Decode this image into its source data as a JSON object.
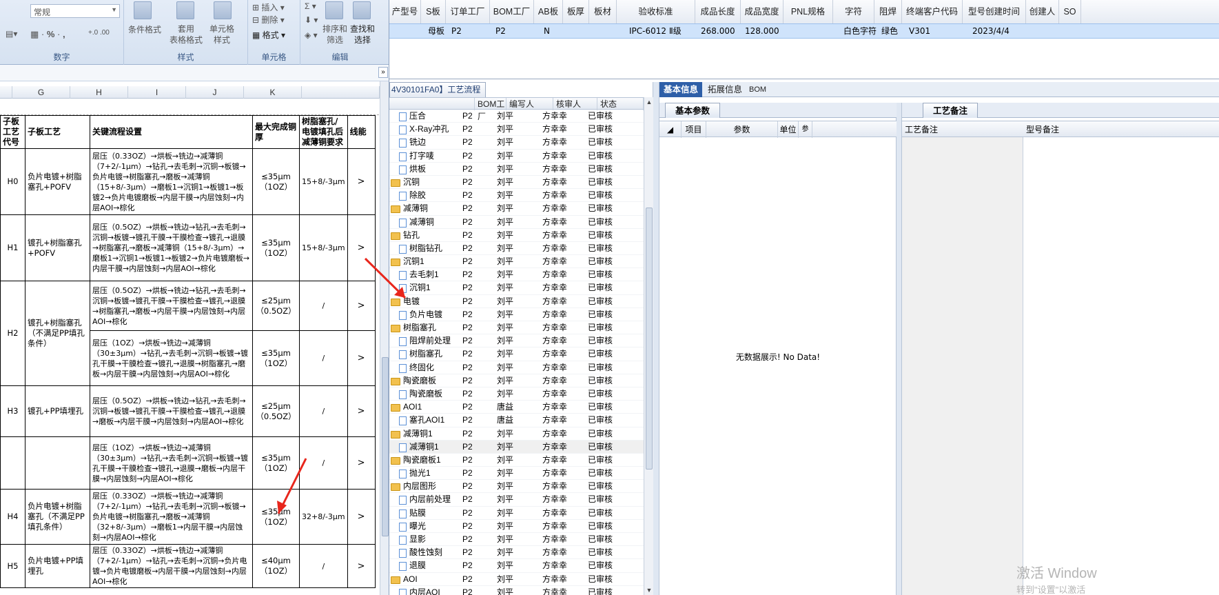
{
  "excel": {
    "number_format": "常规",
    "ribbon": {
      "groups": [
        {
          "label": "数字"
        },
        {
          "label": "样式"
        },
        {
          "label": "单元格"
        },
        {
          "label": "编辑"
        }
      ],
      "buttons": {
        "conditional_format": "条件格式",
        "table_format": "套用\n表格格式",
        "cell_style": "单元格\n样式",
        "insert": "插入",
        "delete": "删除",
        "format": "格式",
        "sort_filter": "排序和\n筛选",
        "find_select": "查找和\n选择"
      }
    },
    "columns": [
      "G",
      "H",
      "I",
      "J",
      "K"
    ],
    "table_headers": [
      "子板工艺代号",
      "子板工艺",
      "关键流程设置",
      "最大完成铜厚",
      "树脂塞孔/电镀填孔后减薄铜要求",
      "线能"
    ],
    "rows": [
      {
        "code": "H0",
        "name": "负片电镀+树脂塞孔+POFV",
        "process": "层压（0.33OZ）→烘板→铣边→减薄铜（7+2/-1μm）→钻孔→去毛刺→沉铜→板镀→负片电镀→树脂塞孔→磨板→减薄铜（15+8/-3μm）→磨板1→沉铜1→板镀1→板镀2→负片电镀磨板→内层干膜→内层蚀刻→内层AOI→棕化",
        "thick": "≤35μm（1OZ）",
        "req": "15+8/-3μm",
        "last": ">"
      },
      {
        "code": "H1",
        "name": "镀孔+树脂塞孔+POFV",
        "process": "层压（0.5OZ）→烘板→铣边→钻孔→去毛刺→沉铜→板镀→镀孔干膜→干膜检查→镀孔→退膜→树脂塞孔→磨板→减薄铜（15+8/-3μm）→磨板1→沉铜1→板镀1→板镀2→负片电镀磨板→内层干膜→内层蚀刻→内层AOI→棕化",
        "thick": "≤35μm（1OZ）",
        "req": "15+8/-3μm",
        "last": ">"
      },
      {
        "code": "H2",
        "name": "镀孔+树脂塞孔（不满足PP填孔条件）",
        "process": "层压（0.5OZ）→烘板→铣边→钻孔→去毛刺→沉铜→板镀→镀孔干膜→干膜检查→镀孔→退膜→树脂塞孔→磨板→内层干膜→内层蚀刻→内层AOI→棕化",
        "thick": "≤25μm（0.5OZ）",
        "req": "/",
        "last": ">"
      },
      {
        "code": "",
        "name": "",
        "process": "层压（1OZ）→烘板→铣边→减薄铜（30±3μm）→钻孔→去毛刺→沉铜→板镀→镀孔干膜→干膜检查→镀孔→退膜→树脂塞孔→磨板→内层干膜→内层蚀刻→内层AOI→棕化",
        "thick": "≤35μm（1OZ）",
        "req": "/",
        "last": ">"
      },
      {
        "code": "H3",
        "name": "镀孔+PP填埋孔",
        "process": "层压（0.5OZ）→烘板→铣边→钻孔→去毛刺→沉铜→板镀→镀孔干膜→干膜检查→镀孔→退膜→磨板→内层干膜→内层蚀刻→内层AOI→棕化",
        "thick": "≤25μm（0.5OZ）",
        "req": "/",
        "last": ">"
      },
      {
        "code": "",
        "name": "",
        "process": "层压（1OZ）→烘板→铣边→减薄铜（30±3μm）→钻孔→去毛刺→沉铜→板镀→镀孔干膜→干膜检查→镀孔→退膜→磨板→内层干膜→内层蚀刻→内层AOI→棕化",
        "thick": "≤35μm（1OZ）",
        "req": "/",
        "last": ">"
      },
      {
        "code": "H4",
        "name": "负片电镀+树脂塞孔（不满足PP填孔条件）",
        "process": "层压（0.33OZ）→烘板→铣边→减薄铜（7+2/-1μm）→钻孔→去毛刺→沉铜→板镀→负片电镀→树脂塞孔→磨板→减薄铜（32+8/-3μm）→磨板1→内层干膜→内层蚀刻→内层AOI→棕化",
        "thick": "≤35μm（1OZ）",
        "req": "32+8/-3μm",
        "last": ">"
      },
      {
        "code": "H5",
        "name": "负片电镀+PP填埋孔",
        "process": "层压（0.33OZ）→烘板→铣边→减薄铜（7+2/-1μm）→钻孔→去毛刺→沉铜→负片电镀→负片电镀磨板→内层干膜→内层蚀刻→内层AOI→棕化",
        "thick": "≤40μm（1OZ）",
        "req": "/",
        "last": ">"
      }
    ]
  },
  "erp": {
    "top_grid": {
      "headers": [
        "产型号",
        "S板",
        "订单工厂",
        "BOM工厂",
        "AB板",
        "板厚",
        "板材",
        "验收标准",
        "成品长度",
        "成品宽度",
        "PNL规格",
        "字符",
        "阻焊",
        "终端客户代码",
        "型号创建时间",
        "创建人",
        "SO"
      ],
      "row": {
        "type": "母板",
        "order_factory": "P2",
        "bom_factory": "P2",
        "ab": "N",
        "standard": "IPC-6012 Ⅱ级",
        "length": "268.000",
        "width": "128.000",
        "char": "白色字符",
        "solder": "绿色",
        "customer": "V301",
        "created": "2023/4/4"
      }
    },
    "tree": {
      "tab_title": "4V30101FA0】工艺流程",
      "headers": [
        "BOM工厂",
        "编写人",
        "核审人",
        "状态"
      ],
      "rows": [
        {
          "name": "压合",
          "level": 1,
          "folder": false,
          "bom": "P2",
          "writer": "刘平",
          "auditor": "方幸幸",
          "status": "已审核"
        },
        {
          "name": "X-Ray冲孔",
          "level": 1,
          "folder": false,
          "bom": "P2",
          "writer": "刘平",
          "auditor": "方幸幸",
          "status": "已审核"
        },
        {
          "name": "铣边",
          "level": 1,
          "folder": false,
          "bom": "P2",
          "writer": "刘平",
          "auditor": "方幸幸",
          "status": "已审核"
        },
        {
          "name": "打字唛",
          "level": 1,
          "folder": false,
          "bom": "P2",
          "writer": "刘平",
          "auditor": "方幸幸",
          "status": "已审核"
        },
        {
          "name": "烘板",
          "level": 1,
          "folder": false,
          "bom": "P2",
          "writer": "刘平",
          "auditor": "方幸幸",
          "status": "已审核"
        },
        {
          "name": "沉铜",
          "level": 0,
          "folder": true,
          "bom": "P2",
          "writer": "刘平",
          "auditor": "方幸幸",
          "status": "已审核"
        },
        {
          "name": "除胶",
          "level": 1,
          "folder": false,
          "bom": "P2",
          "writer": "刘平",
          "auditor": "方幸幸",
          "status": "已审核"
        },
        {
          "name": "减薄铜",
          "level": 0,
          "folder": true,
          "bom": "P2",
          "writer": "刘平",
          "auditor": "方幸幸",
          "status": "已审核"
        },
        {
          "name": "减薄铜",
          "level": 1,
          "folder": false,
          "bom": "P2",
          "writer": "刘平",
          "auditor": "方幸幸",
          "status": "已审核"
        },
        {
          "name": "钻孔",
          "level": 0,
          "folder": true,
          "bom": "P2",
          "writer": "刘平",
          "auditor": "方幸幸",
          "status": "已审核"
        },
        {
          "name": "树脂钻孔",
          "level": 1,
          "folder": false,
          "bom": "P2",
          "writer": "刘平",
          "auditor": "方幸幸",
          "status": "已审核"
        },
        {
          "name": "沉铜1",
          "level": 0,
          "folder": true,
          "bom": "P2",
          "writer": "刘平",
          "auditor": "方幸幸",
          "status": "已审核"
        },
        {
          "name": "去毛刺1",
          "level": 1,
          "folder": false,
          "bom": "P2",
          "writer": "刘平",
          "auditor": "方幸幸",
          "status": "已审核"
        },
        {
          "name": "沉铜1",
          "level": 1,
          "folder": false,
          "bom": "P2",
          "writer": "刘平",
          "auditor": "方幸幸",
          "status": "已审核"
        },
        {
          "name": "电镀",
          "level": 0,
          "folder": true,
          "bom": "P2",
          "writer": "刘平",
          "auditor": "方幸幸",
          "status": "已审核"
        },
        {
          "name": "负片电镀",
          "level": 1,
          "folder": false,
          "bom": "P2",
          "writer": "刘平",
          "auditor": "方幸幸",
          "status": "已审核"
        },
        {
          "name": "树脂塞孔",
          "level": 0,
          "folder": true,
          "bom": "P2",
          "writer": "刘平",
          "auditor": "方幸幸",
          "status": "已审核"
        },
        {
          "name": "阻焊前处理",
          "level": 1,
          "folder": false,
          "bom": "P2",
          "writer": "刘平",
          "auditor": "方幸幸",
          "status": "已审核"
        },
        {
          "name": "树脂塞孔",
          "level": 1,
          "folder": false,
          "bom": "P2",
          "writer": "刘平",
          "auditor": "方幸幸",
          "status": "已审核"
        },
        {
          "name": "终固化",
          "level": 1,
          "folder": false,
          "bom": "P2",
          "writer": "刘平",
          "auditor": "方幸幸",
          "status": "已审核"
        },
        {
          "name": "陶瓷磨板",
          "level": 0,
          "folder": true,
          "bom": "P2",
          "writer": "刘平",
          "auditor": "方幸幸",
          "status": "已审核"
        },
        {
          "name": "陶瓷磨板",
          "level": 1,
          "folder": false,
          "bom": "P2",
          "writer": "刘平",
          "auditor": "方幸幸",
          "status": "已审核"
        },
        {
          "name": "AOI1",
          "level": 0,
          "folder": true,
          "bom": "P2",
          "writer": "唐益",
          "auditor": "方幸幸",
          "status": "已审核"
        },
        {
          "name": "塞孔AOI1",
          "level": 1,
          "folder": false,
          "bom": "P2",
          "writer": "唐益",
          "auditor": "方幸幸",
          "status": "已审核"
        },
        {
          "name": "减薄铜1",
          "level": 0,
          "folder": true,
          "bom": "P2",
          "writer": "刘平",
          "auditor": "方幸幸",
          "status": "已审核"
        },
        {
          "name": "减薄铜1",
          "level": 1,
          "folder": false,
          "bom": "P2",
          "writer": "刘平",
          "auditor": "方幸幸",
          "status": "已审核",
          "selected": true
        },
        {
          "name": "陶瓷磨板1",
          "level": 0,
          "folder": true,
          "bom": "P2",
          "writer": "刘平",
          "auditor": "方幸幸",
          "status": "已审核"
        },
        {
          "name": "抛光1",
          "level": 1,
          "folder": false,
          "bom": "P2",
          "writer": "刘平",
          "auditor": "方幸幸",
          "status": "已审核"
        },
        {
          "name": "内层图形",
          "level": 0,
          "folder": true,
          "bom": "P2",
          "writer": "刘平",
          "auditor": "方幸幸",
          "status": "已审核"
        },
        {
          "name": "内层前处理",
          "level": 1,
          "folder": false,
          "bom": "P2",
          "writer": "刘平",
          "auditor": "方幸幸",
          "status": "已审核"
        },
        {
          "name": "贴膜",
          "level": 1,
          "folder": false,
          "bom": "P2",
          "writer": "刘平",
          "auditor": "方幸幸",
          "status": "已审核"
        },
        {
          "name": "曝光",
          "level": 1,
          "folder": false,
          "bom": "P2",
          "writer": "刘平",
          "auditor": "方幸幸",
          "status": "已审核"
        },
        {
          "name": "显影",
          "level": 1,
          "folder": false,
          "bom": "P2",
          "writer": "刘平",
          "auditor": "方幸幸",
          "status": "已审核"
        },
        {
          "name": "酸性蚀刻",
          "level": 1,
          "folder": false,
          "bom": "P2",
          "writer": "刘平",
          "auditor": "方幸幸",
          "status": "已审核"
        },
        {
          "name": "退膜",
          "level": 1,
          "folder": false,
          "bom": "P2",
          "writer": "刘平",
          "auditor": "方幸幸",
          "status": "已审核"
        },
        {
          "name": "AOI",
          "level": 0,
          "folder": true,
          "bom": "P2",
          "writer": "刘平",
          "auditor": "方幸幸",
          "status": "已审核"
        },
        {
          "name": "内层AOI",
          "level": 1,
          "folder": false,
          "bom": "P2",
          "writer": "刘平",
          "auditor": "方幸幸",
          "status": "已审核"
        }
      ]
    },
    "info_tabs": [
      "基本信息",
      "拓展信息",
      "BOM"
    ],
    "basic_params_title": "基本参数",
    "basic_headers": [
      "项目",
      "参数",
      "单位",
      "参"
    ],
    "no_data": "无数据展示! No Data!",
    "remark_title": "工艺备注",
    "remark_headers": [
      "工艺备注",
      "型号备注"
    ]
  },
  "watermark": {
    "line1": "激活 Window",
    "line2": "转到\"设置\"以激活"
  }
}
